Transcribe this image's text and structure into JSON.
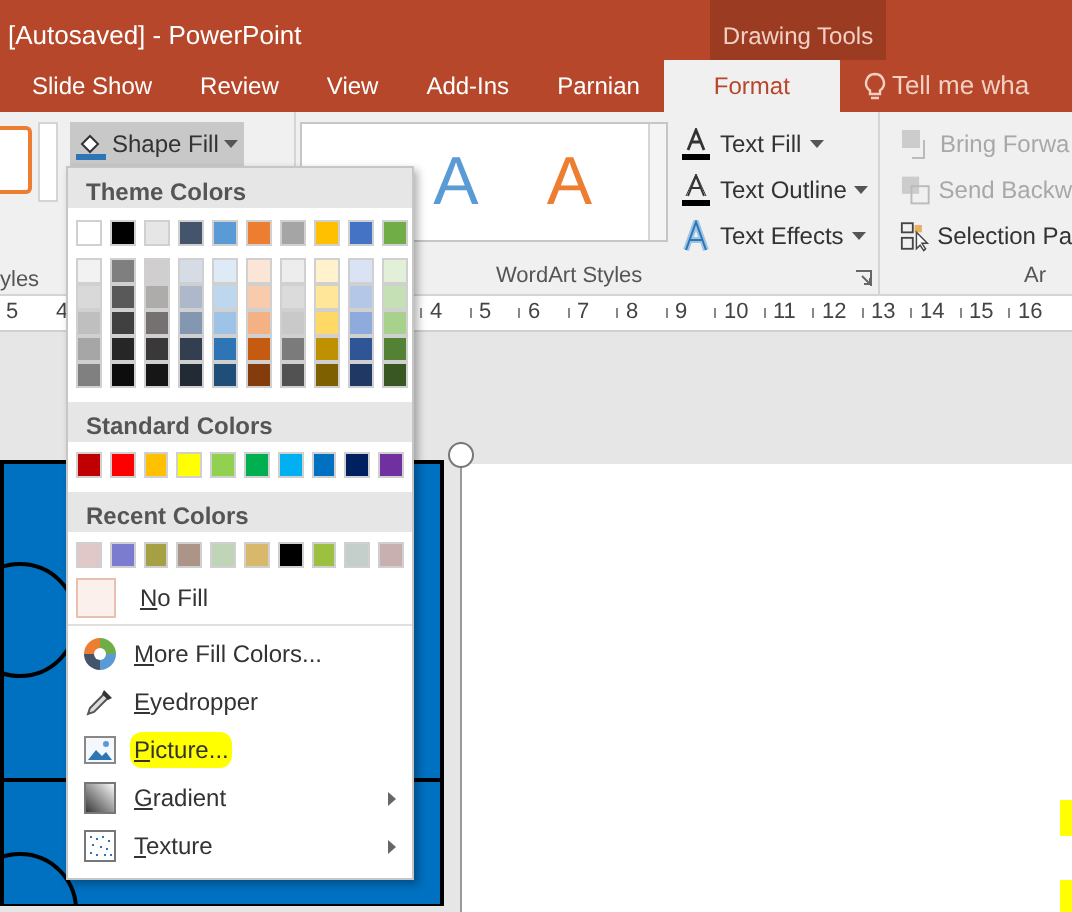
{
  "title_bar": {
    "document_title": "[Autosaved] - PowerPoint",
    "context_tab_group": "Drawing Tools"
  },
  "tabs": [
    {
      "label": "Slide Show",
      "selected": false
    },
    {
      "label": "Review",
      "selected": false
    },
    {
      "label": "View",
      "selected": false
    },
    {
      "label": "Add-Ins",
      "selected": false
    },
    {
      "label": "Parnian",
      "selected": false
    },
    {
      "label": "Format",
      "selected": true
    }
  ],
  "tell_me": {
    "placeholder": "Tell me wha"
  },
  "ribbon": {
    "shape_styles_label": "yles",
    "shape_fill_button": {
      "label": "Shape Fill",
      "pressed": true
    },
    "wordart_gallery": [
      {
        "letter": "A",
        "color": "#5b9bd5"
      },
      {
        "letter": "A",
        "color": "#ed7d31"
      }
    ],
    "wordart_commands": [
      {
        "label": "Text Fill",
        "kind": "fill"
      },
      {
        "label": "Text Outline",
        "kind": "outline"
      },
      {
        "label": "Text Effects",
        "kind": "effects"
      }
    ],
    "wordart_label": "WordArt Styles",
    "arrange_commands": [
      {
        "label": "Bring Forwa",
        "kind": "bring",
        "disabled": true
      },
      {
        "label": "Send Backw",
        "kind": "send",
        "disabled": true
      },
      {
        "label": "Selection Pa",
        "kind": "selection",
        "disabled": false
      }
    ],
    "arrange_label": "Ar"
  },
  "ruler": {
    "left_numbers": [
      "5",
      "4"
    ],
    "right_numbers": [
      "4",
      "5",
      "6",
      "7",
      "8",
      "9",
      "10",
      "11",
      "12",
      "13",
      "14",
      "15",
      "16"
    ]
  },
  "shape_fill_menu": {
    "theme_colors": {
      "heading": "Theme Colors",
      "columns": [
        {
          "color": "#ffffff",
          "shades": [
            {
              "color": "#f2f2f2"
            },
            {
              "color": "#d9d9d9"
            },
            {
              "color": "#bfbfbf"
            },
            {
              "color": "#a6a6a6"
            },
            {
              "color": "#808080"
            }
          ]
        },
        {
          "color": "#000000",
          "shades": [
            {
              "color": "#7f7f7f"
            },
            {
              "color": "#595959"
            },
            {
              "color": "#404040"
            },
            {
              "color": "#262626"
            },
            {
              "color": "#0d0d0d"
            }
          ]
        },
        {
          "color": "#e7e6e6",
          "shades": [
            {
              "color": "#d0cece"
            },
            {
              "color": "#aeabab"
            },
            {
              "color": "#757171"
            },
            {
              "color": "#3a3838"
            },
            {
              "color": "#171616"
            }
          ]
        },
        {
          "color": "#44546a",
          "shades": [
            {
              "color": "#d6dce5"
            },
            {
              "color": "#adb9ca"
            },
            {
              "color": "#8497b0"
            },
            {
              "color": "#333f50"
            },
            {
              "color": "#222a35"
            }
          ]
        },
        {
          "color": "#5b9bd5",
          "shades": [
            {
              "color": "#deebf7"
            },
            {
              "color": "#bdd7ee"
            },
            {
              "color": "#9dc3e6"
            },
            {
              "color": "#2e75b6"
            },
            {
              "color": "#1f4e79"
            }
          ]
        },
        {
          "color": "#ed7d31",
          "shades": [
            {
              "color": "#fbe5d6"
            },
            {
              "color": "#f8cbad"
            },
            {
              "color": "#f4b183"
            },
            {
              "color": "#c55a11"
            },
            {
              "color": "#843c0c"
            }
          ]
        },
        {
          "color": "#a5a5a5",
          "shades": [
            {
              "color": "#ededed"
            },
            {
              "color": "#dbdbdb"
            },
            {
              "color": "#c9c9c9"
            },
            {
              "color": "#7b7b7b"
            },
            {
              "color": "#525252"
            }
          ]
        },
        {
          "color": "#ffc000",
          "shades": [
            {
              "color": "#fff2cc"
            },
            {
              "color": "#ffe699"
            },
            {
              "color": "#ffd966"
            },
            {
              "color": "#bf9000"
            },
            {
              "color": "#7f6000"
            }
          ]
        },
        {
          "color": "#4472c4",
          "shades": [
            {
              "color": "#dae3f3"
            },
            {
              "color": "#b4c7e7"
            },
            {
              "color": "#8faadc"
            },
            {
              "color": "#2f5597"
            },
            {
              "color": "#203864"
            }
          ]
        },
        {
          "color": "#70ad47",
          "shades": [
            {
              "color": "#e2f0d9"
            },
            {
              "color": "#c5e0b4"
            },
            {
              "color": "#a9d18e"
            },
            {
              "color": "#548235"
            },
            {
              "color": "#385723"
            }
          ]
        }
      ]
    },
    "standard_colors": {
      "heading": "Standard Colors",
      "swatches": [
        {
          "color": "#c00000"
        },
        {
          "color": "#ff0000"
        },
        {
          "color": "#ffc000"
        },
        {
          "color": "#ffff00"
        },
        {
          "color": "#92d050"
        },
        {
          "color": "#00b050"
        },
        {
          "color": "#00b0f0"
        },
        {
          "color": "#0070c0"
        },
        {
          "color": "#002060"
        },
        {
          "color": "#7030a0"
        }
      ]
    },
    "recent_colors": {
      "heading": "Recent Colors",
      "swatches": [
        {
          "color": "#e0c8c8"
        },
        {
          "color": "#7b7bd0"
        },
        {
          "color": "#a5a044"
        },
        {
          "color": "#ac9488"
        },
        {
          "color": "#c0d4b8"
        },
        {
          "color": "#d8b86a"
        },
        {
          "color": "#000000"
        },
        {
          "color": "#9cc040"
        },
        {
          "color": "#c4cfcc"
        },
        {
          "color": "#c9b0b0"
        }
      ]
    },
    "no_fill": {
      "label": "No Fill"
    },
    "items": [
      {
        "label": "More Fill Colors...",
        "kind": "colors",
        "highlighted": false,
        "submenu": false
      },
      {
        "label": "Eyedropper",
        "kind": "eyedropper",
        "highlighted": false,
        "submenu": false
      },
      {
        "label": "Picture...",
        "kind": "picture",
        "highlighted": true,
        "submenu": false
      },
      {
        "label": "Gradient",
        "kind": "gradient",
        "highlighted": false,
        "submenu": true
      },
      {
        "label": "Texture",
        "kind": "texture",
        "highlighted": false,
        "submenu": true
      }
    ]
  }
}
